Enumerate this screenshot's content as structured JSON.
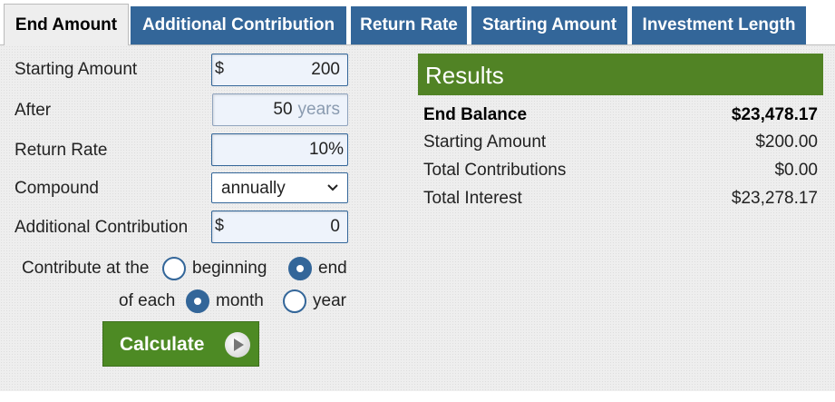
{
  "tabs": [
    {
      "label": "End Amount",
      "active": true
    },
    {
      "label": "Additional Contribution",
      "active": false
    },
    {
      "label": "Return Rate",
      "active": false
    },
    {
      "label": "Starting Amount",
      "active": false
    },
    {
      "label": "Investment Length",
      "active": false
    }
  ],
  "form": {
    "starting_amount": {
      "label": "Starting Amount",
      "prefix": "$",
      "value": "200"
    },
    "after": {
      "label": "After",
      "value": "50",
      "unit": "years"
    },
    "return_rate": {
      "label": "Return Rate",
      "value": "10",
      "unit": "%"
    },
    "compound": {
      "label": "Compound",
      "selected": "annually"
    },
    "additional_contribution": {
      "label": "Additional Contribution",
      "prefix": "$",
      "value": "0"
    },
    "contribute_at": {
      "label": "Contribute at the",
      "options": [
        "beginning",
        "end"
      ],
      "selected": "end"
    },
    "of_each": {
      "label": "of each",
      "options": [
        "month",
        "year"
      ],
      "selected": "month"
    },
    "calculate_label": "Calculate"
  },
  "results": {
    "title": "Results",
    "rows": [
      {
        "label": "End Balance",
        "value": "$23,478.17",
        "bold": true
      },
      {
        "label": "Starting Amount",
        "value": "$200.00",
        "bold": false
      },
      {
        "label": "Total Contributions",
        "value": "$0.00",
        "bold": false
      },
      {
        "label": "Total Interest",
        "value": "$23,278.17",
        "bold": false
      }
    ]
  },
  "colors": {
    "tab_blue": "#336699",
    "results_green": "#518325",
    "calculate_green": "#4d8a24",
    "panel_bg": "#eeeeee"
  }
}
